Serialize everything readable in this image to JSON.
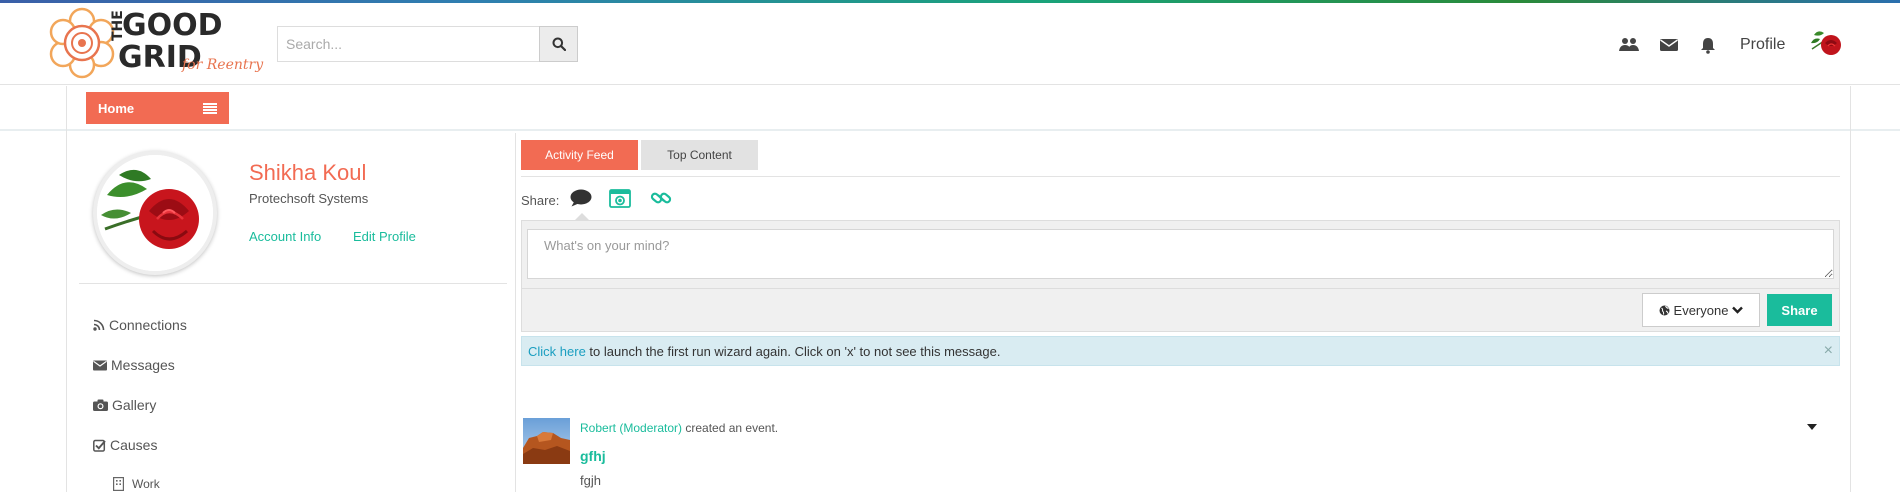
{
  "brand": {
    "logo_line1": "THE",
    "logo_line2": "GOOD",
    "logo_line3": "GRID",
    "logo_tagline": "for Reentry"
  },
  "search": {
    "placeholder": "Search...",
    "value": ""
  },
  "header": {
    "icons": [
      "users-icon",
      "envelope-icon",
      "bell-icon"
    ],
    "profile_label": "Profile"
  },
  "nav": {
    "home_label": "Home"
  },
  "profile": {
    "name": "Shikha Koul",
    "company": "Protechsoft Systems",
    "account_info_label": "Account Info",
    "edit_profile_label": "Edit Profile"
  },
  "sidebar": {
    "items": [
      {
        "label": "Connections",
        "icon": "rss-icon"
      },
      {
        "label": "Messages",
        "icon": "envelope-icon"
      },
      {
        "label": "Gallery",
        "icon": "camera-icon"
      },
      {
        "label": "Causes",
        "icon": "check-square-icon"
      }
    ],
    "sub_items": [
      {
        "label": "Work",
        "icon": "building-icon"
      }
    ]
  },
  "tabs": [
    {
      "label": "Activity Feed",
      "active": true
    },
    {
      "label": "Top Content",
      "active": false
    }
  ],
  "share": {
    "label": "Share:",
    "icons": [
      "comment-icon",
      "photo-icon",
      "link-icon"
    ]
  },
  "composer": {
    "placeholder": "What's on your mind?",
    "privacy_label": "Everyone",
    "share_label": "Share"
  },
  "wizard_alert": {
    "link_text": "Click here",
    "message": " to launch the first run wizard again. Click on 'x' to not see this message.",
    "close_label": "×"
  },
  "feed": [
    {
      "author": "Robert (Moderator)",
      "action": " created an event.",
      "title": "gfhj",
      "body": "fgjh"
    }
  ],
  "colors": {
    "accent": "#f26b53",
    "teal": "#1abc9c",
    "alert_bg": "#d9ecf2"
  }
}
